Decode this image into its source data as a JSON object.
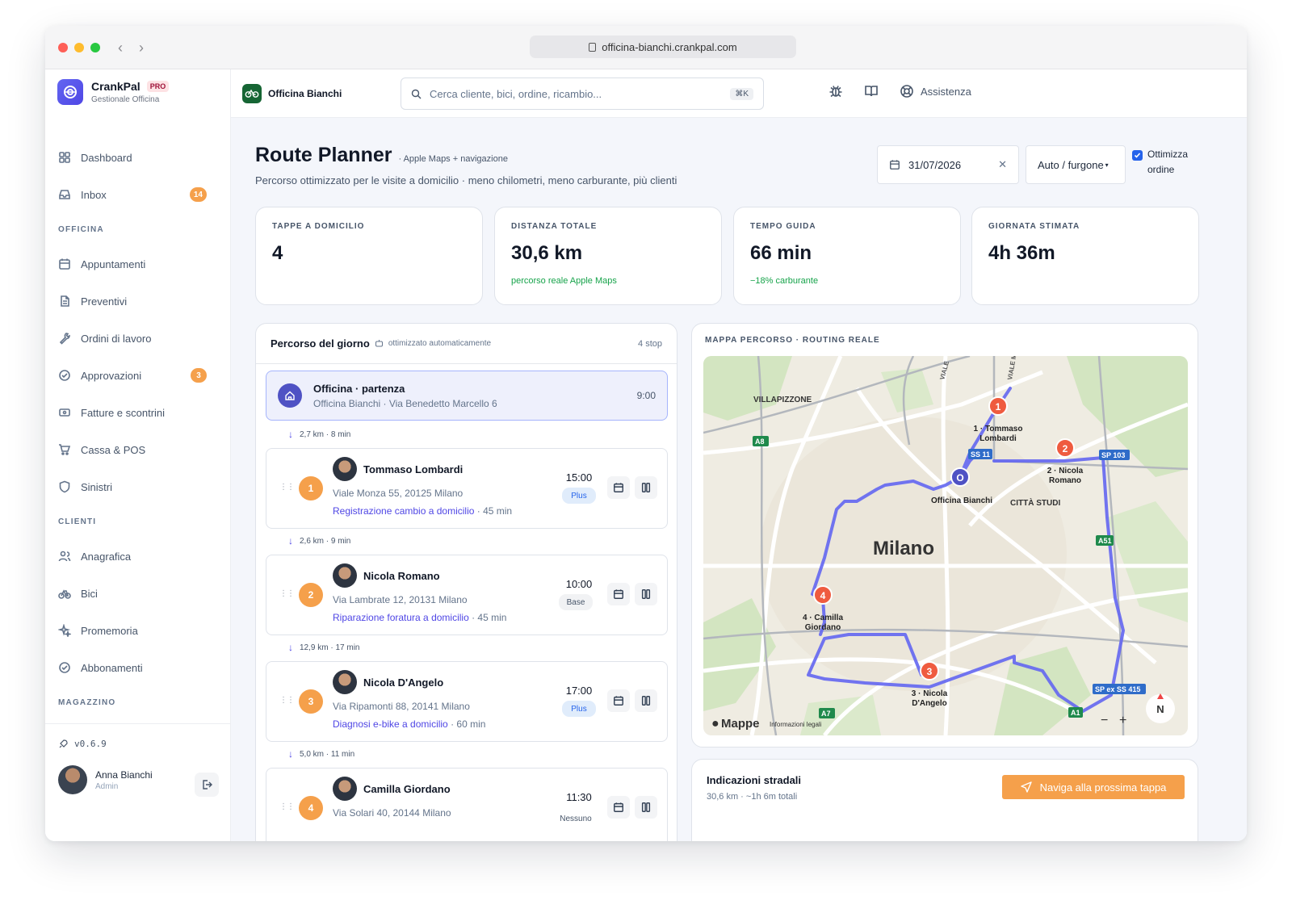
{
  "browser": {
    "url": "officina-bianchi.crankpal.com"
  },
  "brand": {
    "name": "CrankPal",
    "badge": "PRO",
    "subtitle": "Gestionale Officina"
  },
  "sidebar": {
    "items_top": [
      {
        "label": "Dashboard",
        "icon": "grid-icon"
      },
      {
        "label": "Inbox",
        "icon": "inbox-icon",
        "badge": "14"
      }
    ],
    "section_officina": "OFFICINA",
    "items_officina": [
      {
        "label": "Appuntamenti",
        "icon": "calendar-icon"
      },
      {
        "label": "Preventivi",
        "icon": "document-icon"
      },
      {
        "label": "Ordini di lavoro",
        "icon": "wrench-icon"
      },
      {
        "label": "Approvazioni",
        "icon": "check-circle-icon",
        "badge": "3"
      },
      {
        "label": "Fatture e scontrini",
        "icon": "receipt-icon"
      },
      {
        "label": "Cassa & POS",
        "icon": "cart-icon"
      },
      {
        "label": "Sinistri",
        "icon": "shield-icon"
      }
    ],
    "section_clienti": "CLIENTI",
    "items_clienti": [
      {
        "label": "Anagrafica",
        "icon": "users-icon"
      },
      {
        "label": "Bici",
        "icon": "bike-icon"
      },
      {
        "label": "Promemoria",
        "icon": "sparkle-icon"
      },
      {
        "label": "Abbonamenti",
        "icon": "check-circle-icon"
      }
    ],
    "section_magazzino": "MAGAZZINO",
    "version": "v0.6.9",
    "user": {
      "name": "Anna Bianchi",
      "role": "Admin"
    }
  },
  "topbar": {
    "shop_name": "Officina Bianchi",
    "search_placeholder": "Cerca cliente, bici, ordine, ricambio...",
    "search_shortcut": "⌘K",
    "help_label": "Assistenza"
  },
  "page": {
    "title": "Route Planner",
    "title_note": "· Apple Maps + navigazione",
    "subtitle": "Percorso ottimizzato per le visite a domicilio · meno chilometri, meno carburante, più clienti",
    "date": "31/07/2026",
    "vehicle": "Auto / furgone",
    "optimize_label_1": "Ottimizza",
    "optimize_label_2": "ordine"
  },
  "stats": [
    {
      "label": "TAPPE A DOMICILIO",
      "value": "4",
      "note": ""
    },
    {
      "label": "DISTANZA TOTALE",
      "value": "30,6 km",
      "note": "percorso reale Apple Maps"
    },
    {
      "label": "TEMPO GUIDA",
      "value": "66 min",
      "note": "−18% carburante"
    },
    {
      "label": "GIORNATA STIMATA",
      "value": "4h 36m",
      "note": ""
    }
  ],
  "route": {
    "title": "Percorso del giorno",
    "auto_note": "ottimizzato automaticamente",
    "count": "4 stop",
    "start": {
      "title": "Officina · partenza",
      "address": "Officina Bianchi · Via Benedetto Marcello 6",
      "time": "9:00"
    },
    "legs": [
      "2,7 km · 8 min",
      "2,6 km · 9 min",
      "12,9 km · 17 min",
      "5,0 km · 11 min"
    ],
    "stops": [
      {
        "num": "1",
        "name": "Tommaso Lombardi",
        "address": "Viale Monza 55, 20125 Milano",
        "service": "Registrazione cambio a domicilio",
        "duration": " · 45 min",
        "time": "15:00",
        "plan": "Plus"
      },
      {
        "num": "2",
        "name": "Nicola Romano",
        "address": "Via Lambrate 12, 20131 Milano",
        "service": "Riparazione foratura a domicilio",
        "duration": " · 45 min",
        "time": "10:00",
        "plan": "Base"
      },
      {
        "num": "3",
        "name": "Nicola D'Angelo",
        "address": "Via Ripamonti 88, 20141 Milano",
        "service": "Diagnosi e-bike a domicilio",
        "duration": " · 60 min",
        "time": "17:00",
        "plan": "Plus"
      },
      {
        "num": "4",
        "name": "Camilla Giordano",
        "address": "Via Solari 40, 20144 Milano",
        "service": "",
        "duration": "",
        "time": "11:30",
        "plan": "Nessuno"
      }
    ]
  },
  "map": {
    "label": "MAPPA PERCORSO · ROUTING REALE",
    "city": "Milano",
    "districts": [
      "VILLAPIZZONE",
      "CITTÀ STUDI"
    ],
    "road_tags": [
      "A8",
      "SS 11",
      "SP 103",
      "A51",
      "A7",
      "SP ex SS 415",
      "A1"
    ],
    "street_labels": [
      "VIALE",
      "VIALE M"
    ],
    "pins": [
      {
        "num": "O",
        "label": "Officina Bianchi"
      },
      {
        "num": "1",
        "label_1": "1 · Tommaso",
        "label_2": "Lombardi"
      },
      {
        "num": "2",
        "label_1": "2 · Nicola",
        "label_2": "Romano"
      },
      {
        "num": "3",
        "label_1": "3 · Nicola",
        "label_2": "D'Angelo"
      },
      {
        "num": "4",
        "label_1": "4 · Camilla",
        "label_2": "Giordano"
      }
    ],
    "brand": "Mappe",
    "legal": "Informazioni legali",
    "compass": "N",
    "zoom_out": "−",
    "zoom_in": "+",
    "route_color": "#6366f1",
    "pin_color": "#ef5b3f"
  },
  "directions": {
    "title": "Indicazioni stradali",
    "summary": "30,6 km · ~1h 6m totali",
    "button": "Naviga alla prossima tappa"
  },
  "colors": {
    "accent": "#f5a04b",
    "primary": "#4f46e5"
  }
}
